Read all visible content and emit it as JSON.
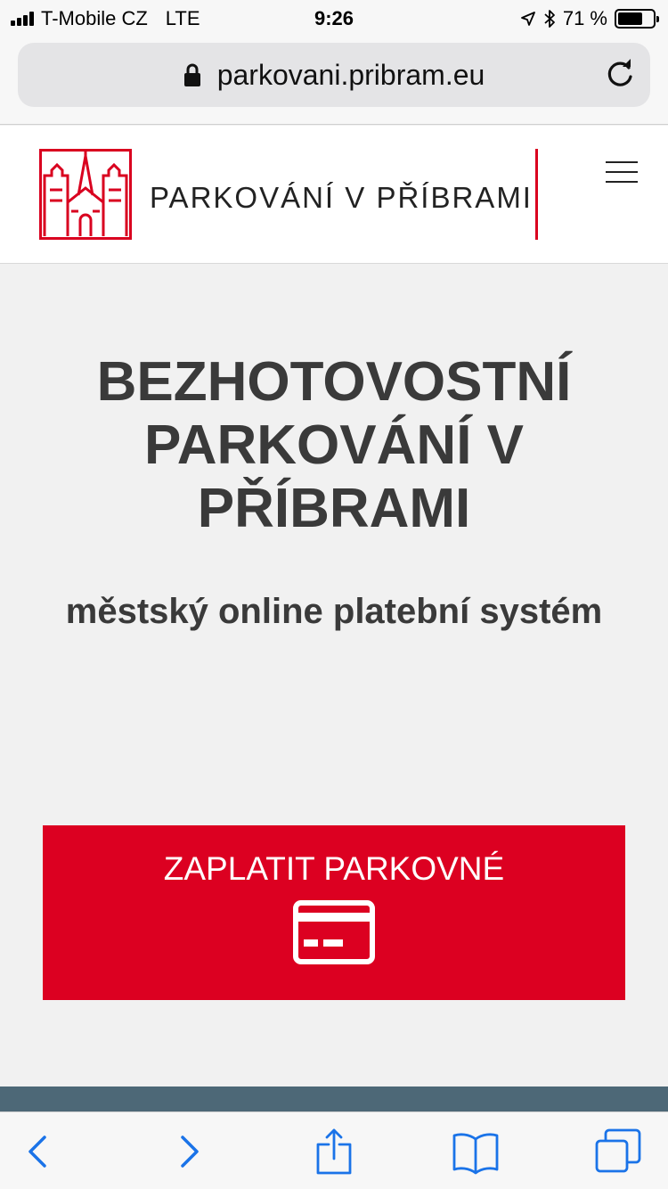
{
  "status_bar": {
    "carrier": "T-Mobile CZ",
    "network": "LTE",
    "time": "9:26",
    "battery": "71 %",
    "battery_level": 0.71
  },
  "browser": {
    "url": "parkovani.pribram.eu"
  },
  "header": {
    "site_name": "PARKOVÁNÍ V PŘÍBRAMI",
    "brand_color": "#d9001f"
  },
  "hero": {
    "title": "BEZHOTOVOSTNÍ PARKOVÁNÍ V PŘÍBRAMI",
    "subtitle": "městský online platební systém"
  },
  "cta": {
    "label": "ZAPLATIT PARKOVNÉ",
    "color": "#dc0021"
  }
}
